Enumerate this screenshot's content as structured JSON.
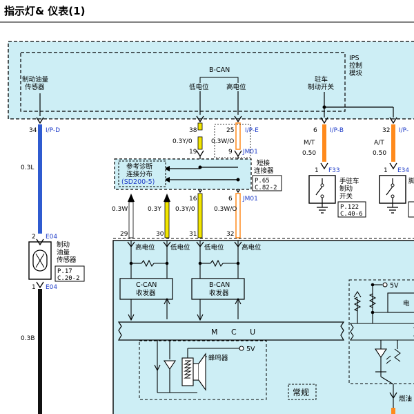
{
  "header": {
    "title": "指示灯& 仪表(1)"
  },
  "colors": {
    "module_fill": "#cdeef5",
    "wire_blue": "#2f5bd0",
    "wire_yellow": "#f2e600",
    "wire_orange": "#ff8a1c",
    "wire_black": "#111111",
    "connector_text": "#1f3cc8"
  },
  "ips": {
    "name": [
      "IPS",
      "控制",
      "模块"
    ],
    "brake_fluid_label": [
      "制动油量",
      "传感器"
    ],
    "bcan_label": "B-CAN",
    "low_level": "低电位",
    "high_level": "高电位",
    "parking_label": [
      "驻车",
      "制动开关"
    ]
  },
  "wires": {
    "w1": {
      "pin": "34",
      "conn": "I/P-D",
      "spec": "0.3L",
      "pin_e04_top": "2",
      "conn_e04_top": "E04",
      "pin_e04_bot": "1",
      "conn_e04_bot": "E04",
      "spec_bot": "0.3B"
    },
    "w2": {
      "pin": "38",
      "spec": "0.3Y/0",
      "pin_jm": "19",
      "pin_lower": "16",
      "spec_lower": "0.3Y/0",
      "pin_cluster": "31"
    },
    "w3": {
      "pin": "25",
      "conn": "I/P-E",
      "spec": "0.3W/O",
      "pin_jm": "9",
      "conn_jm": "JM01",
      "pin_lower": "6",
      "conn_lower": "JM01",
      "spec_lower": "0.3W/O",
      "pin_cluster": "32"
    },
    "w4": {
      "pin": "6",
      "conn": "I/P-B",
      "variant": "M/T",
      "spec": "0.50",
      "pin_f": "1",
      "conn_f": "F33"
    },
    "w5": {
      "pin": "32",
      "conn": "I/P-",
      "variant": "A/T",
      "spec": "0.50",
      "pin_e": "1",
      "conn_e": "E34"
    },
    "w6": {
      "spec": "0.3W",
      "pin_cluster": "29"
    },
    "w7": {
      "spec": "0.3Y",
      "pin_cluster": "30"
    }
  },
  "diag_box": {
    "lines": [
      "参考诊断",
      "连接分布",
      "(SD200-5)"
    ]
  },
  "jumper": {
    "name": [
      "短接",
      "连接器"
    ],
    "ref": [
      "P.65",
      "C.82-2"
    ]
  },
  "sensor": {
    "name": [
      "制动",
      "油量",
      "传感器"
    ],
    "ref": [
      "P.17",
      "C.20-2"
    ]
  },
  "hand_switch": {
    "name": [
      "手驻车",
      "制动",
      "开关"
    ],
    "ref": [
      "P.122",
      "C.40-6"
    ]
  },
  "foot_switch": {
    "name": [
      "脚"
    ]
  },
  "cluster": {
    "cluster_labels": [
      "高电位",
      "低电位",
      "低电位",
      "高电位"
    ],
    "ccan": [
      "C-CAN",
      "收发器"
    ],
    "bcan": [
      "B-CAN",
      "收发器"
    ],
    "mcu": "M C U",
    "buzzer": "蜂鸣器",
    "voltage_5v": "5V",
    "voltage_5v_right": "5V",
    "normal": "常规",
    "right_box": "电",
    "fuel": "燃油"
  }
}
